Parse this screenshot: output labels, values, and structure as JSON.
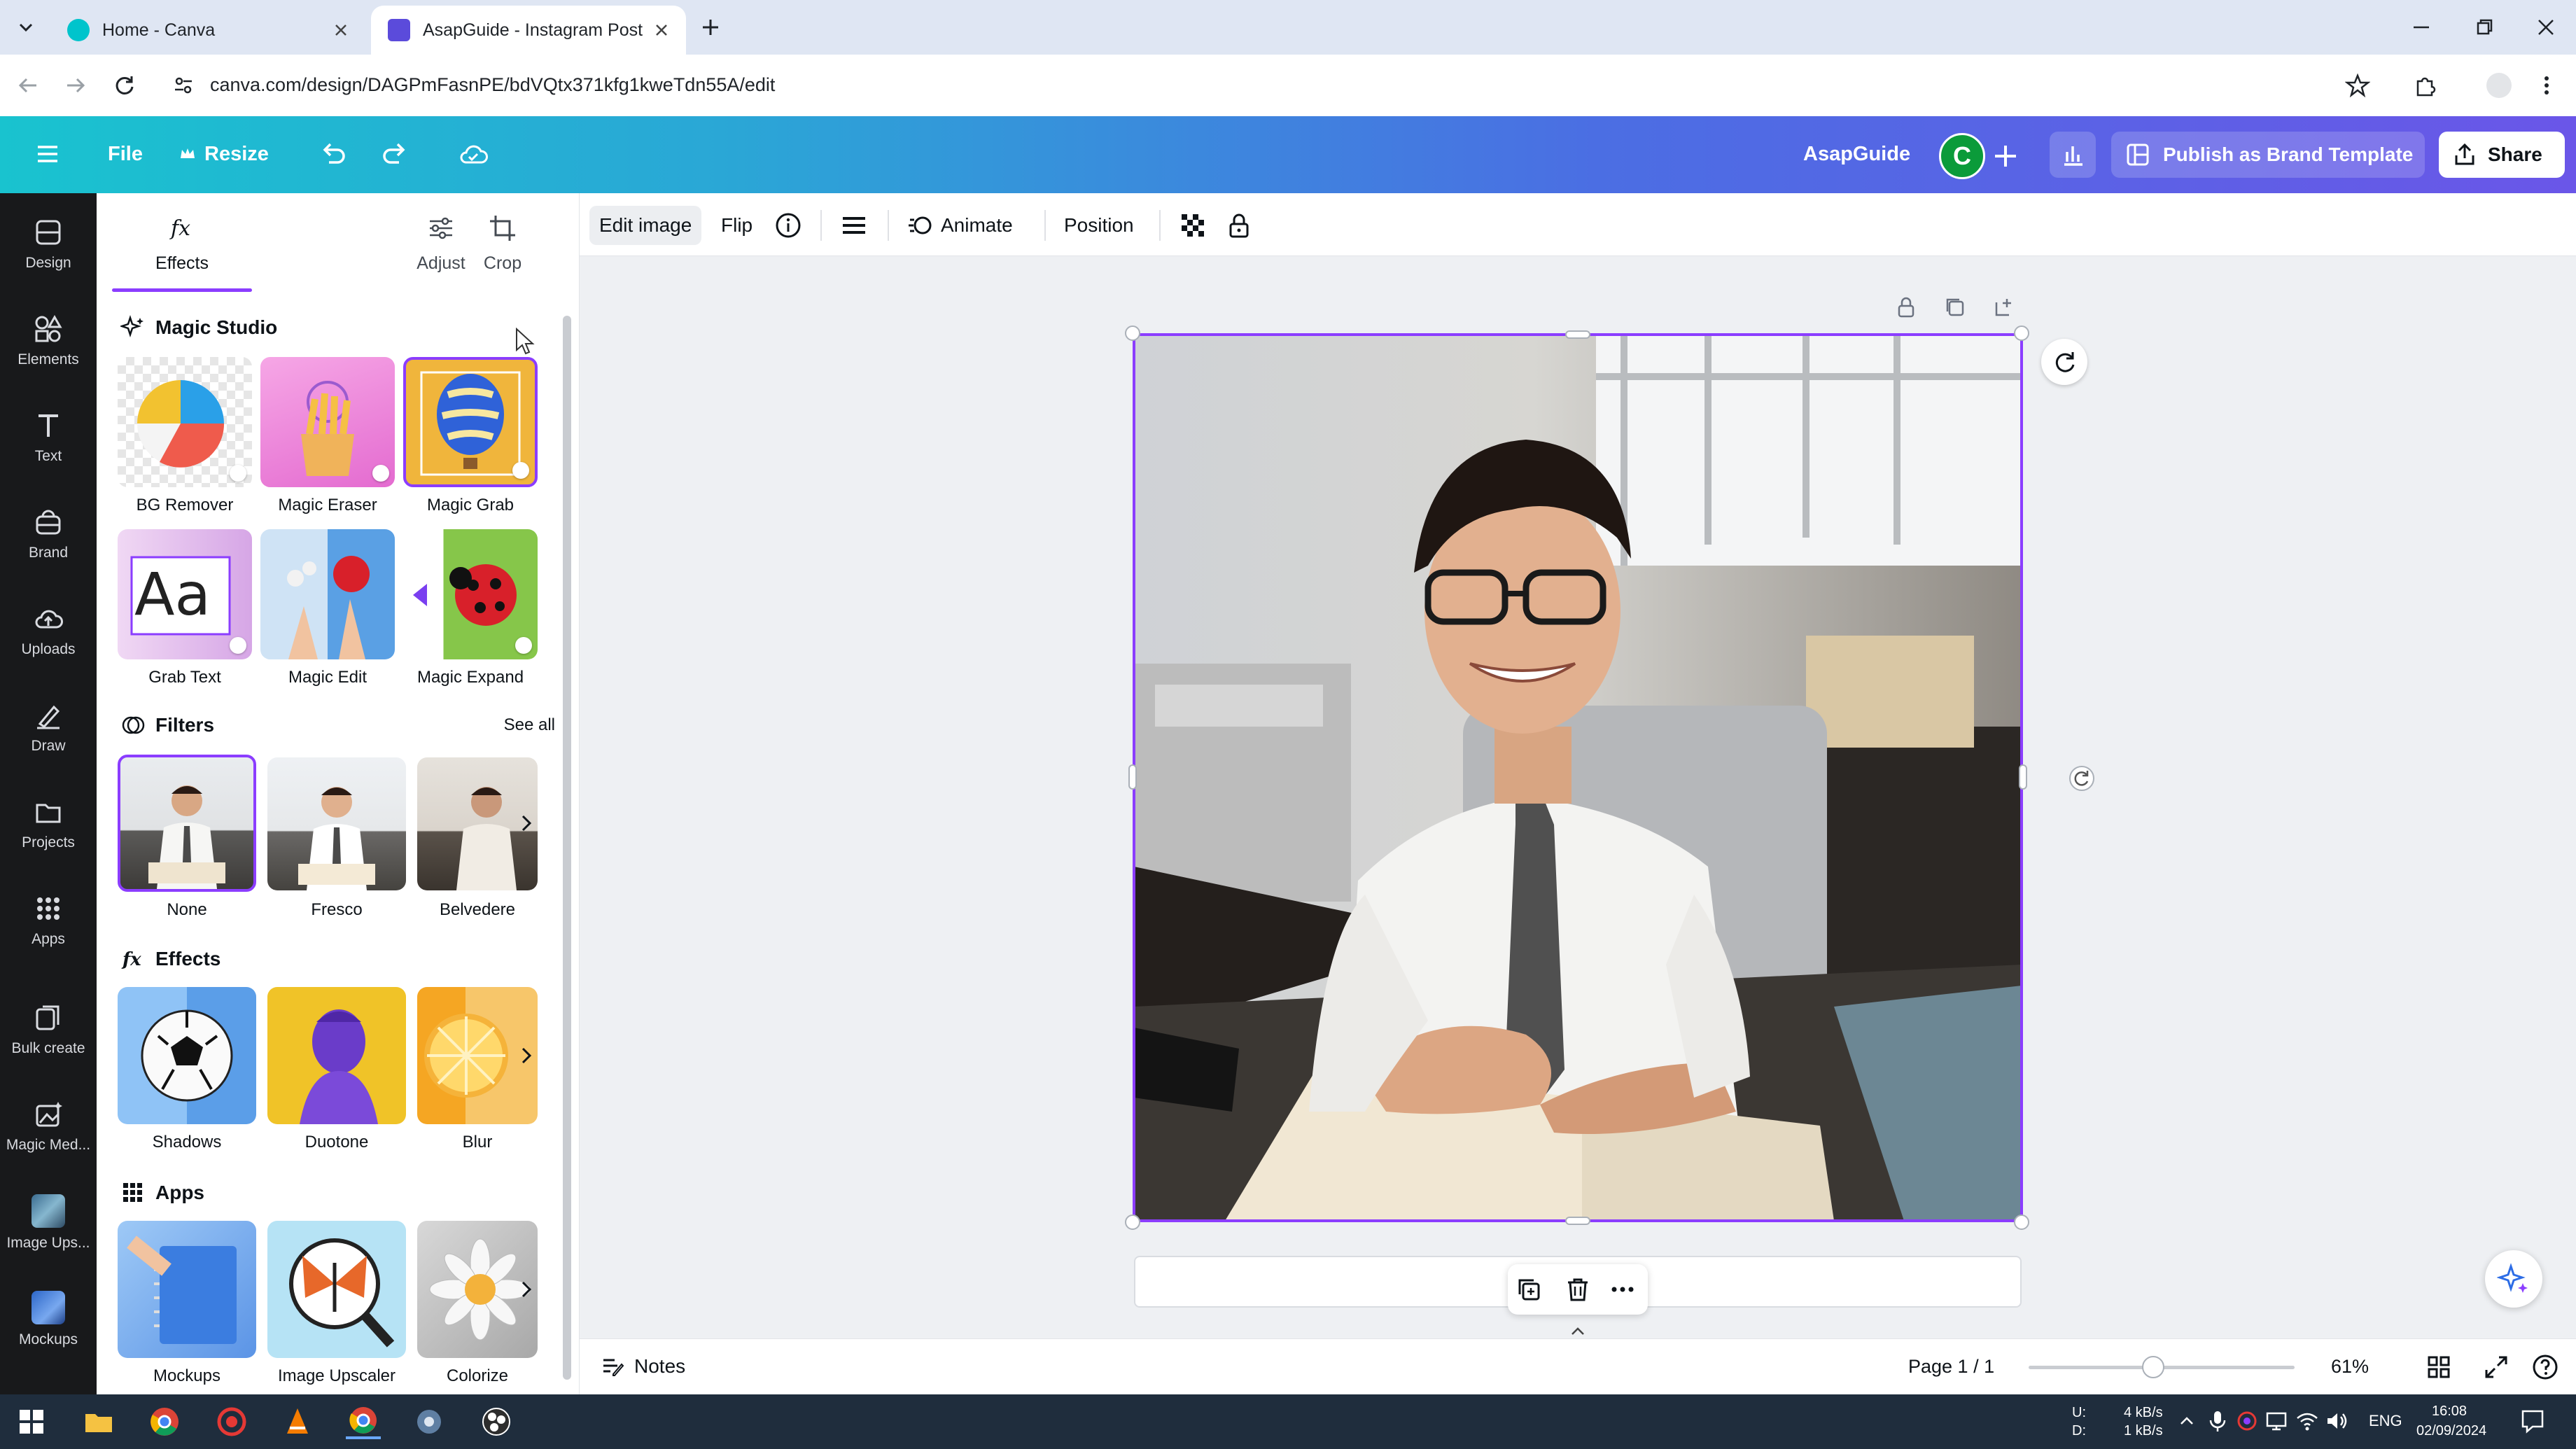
{
  "browser": {
    "tabs": [
      {
        "title": "Home - Canva",
        "active": false
      },
      {
        "title": "AsapGuide - Instagram Post",
        "active": true
      }
    ],
    "url": "canva.com/design/DAGPmFasnPE/bdVQtx371kfg1kweTdn55A/edit"
  },
  "topbar": {
    "file": "File",
    "resize": "Resize",
    "brand_name": "AsapGuide",
    "avatar_letter": "C",
    "publish": "Publish as Brand Template",
    "share": "Share"
  },
  "rail": [
    {
      "label": "Design",
      "icon": "design-icon"
    },
    {
      "label": "Elements",
      "icon": "elements-icon"
    },
    {
      "label": "Text",
      "icon": "text-icon"
    },
    {
      "label": "Brand",
      "icon": "brand-icon"
    },
    {
      "label": "Uploads",
      "icon": "uploads-icon"
    },
    {
      "label": "Draw",
      "icon": "draw-icon"
    },
    {
      "label": "Projects",
      "icon": "projects-icon"
    },
    {
      "label": "Apps",
      "icon": "apps-icon"
    },
    {
      "label": "Bulk create",
      "icon": "bulk-create-icon"
    },
    {
      "label": "Magic Med...",
      "icon": "magic-media-icon"
    },
    {
      "label": "Image Ups...",
      "icon": "image-upscaler-icon"
    },
    {
      "label": "Mockups",
      "icon": "mockups-icon"
    }
  ],
  "panel": {
    "tabs": [
      {
        "label": "Effects",
        "active": true
      },
      {
        "label": "Adjust"
      },
      {
        "label": "Crop"
      }
    ],
    "magic_studio": {
      "title": "Magic Studio",
      "items": [
        {
          "label": "BG Remover"
        },
        {
          "label": "Magic Eraser"
        },
        {
          "label": "Magic Grab"
        },
        {
          "label": "Grab Text"
        },
        {
          "label": "Magic Edit"
        },
        {
          "label": "Magic Expand"
        }
      ]
    },
    "filters": {
      "title": "Filters",
      "see_all": "See all",
      "items": [
        {
          "label": "None"
        },
        {
          "label": "Fresco"
        },
        {
          "label": "Belvedere"
        }
      ]
    },
    "effects": {
      "title": "Effects",
      "items": [
        {
          "label": "Shadows"
        },
        {
          "label": "Duotone"
        },
        {
          "label": "Blur"
        }
      ]
    },
    "apps": {
      "title": "Apps",
      "items": [
        {
          "label": "Mockups"
        },
        {
          "label": "Image Upscaler"
        },
        {
          "label": "Colorize"
        }
      ]
    }
  },
  "context_toolbar": {
    "edit_image": "Edit image",
    "flip": "Flip",
    "animate": "Animate",
    "position": "Position"
  },
  "bottom": {
    "notes": "Notes",
    "page": "Page 1 / 1",
    "zoom": "61%",
    "zoom_fraction": 0.61
  },
  "taskbar": {
    "net_up": "4 kB/s",
    "net_down": "1 kB/s",
    "net_u": "U:",
    "net_d": "D:",
    "lang": "ENG",
    "time": "16:08",
    "date": "02/09/2024"
  },
  "colors": {
    "accent": "#8b3dff",
    "rail_bg": "#18191b",
    "avatar_bg": "#0b9b3a"
  }
}
